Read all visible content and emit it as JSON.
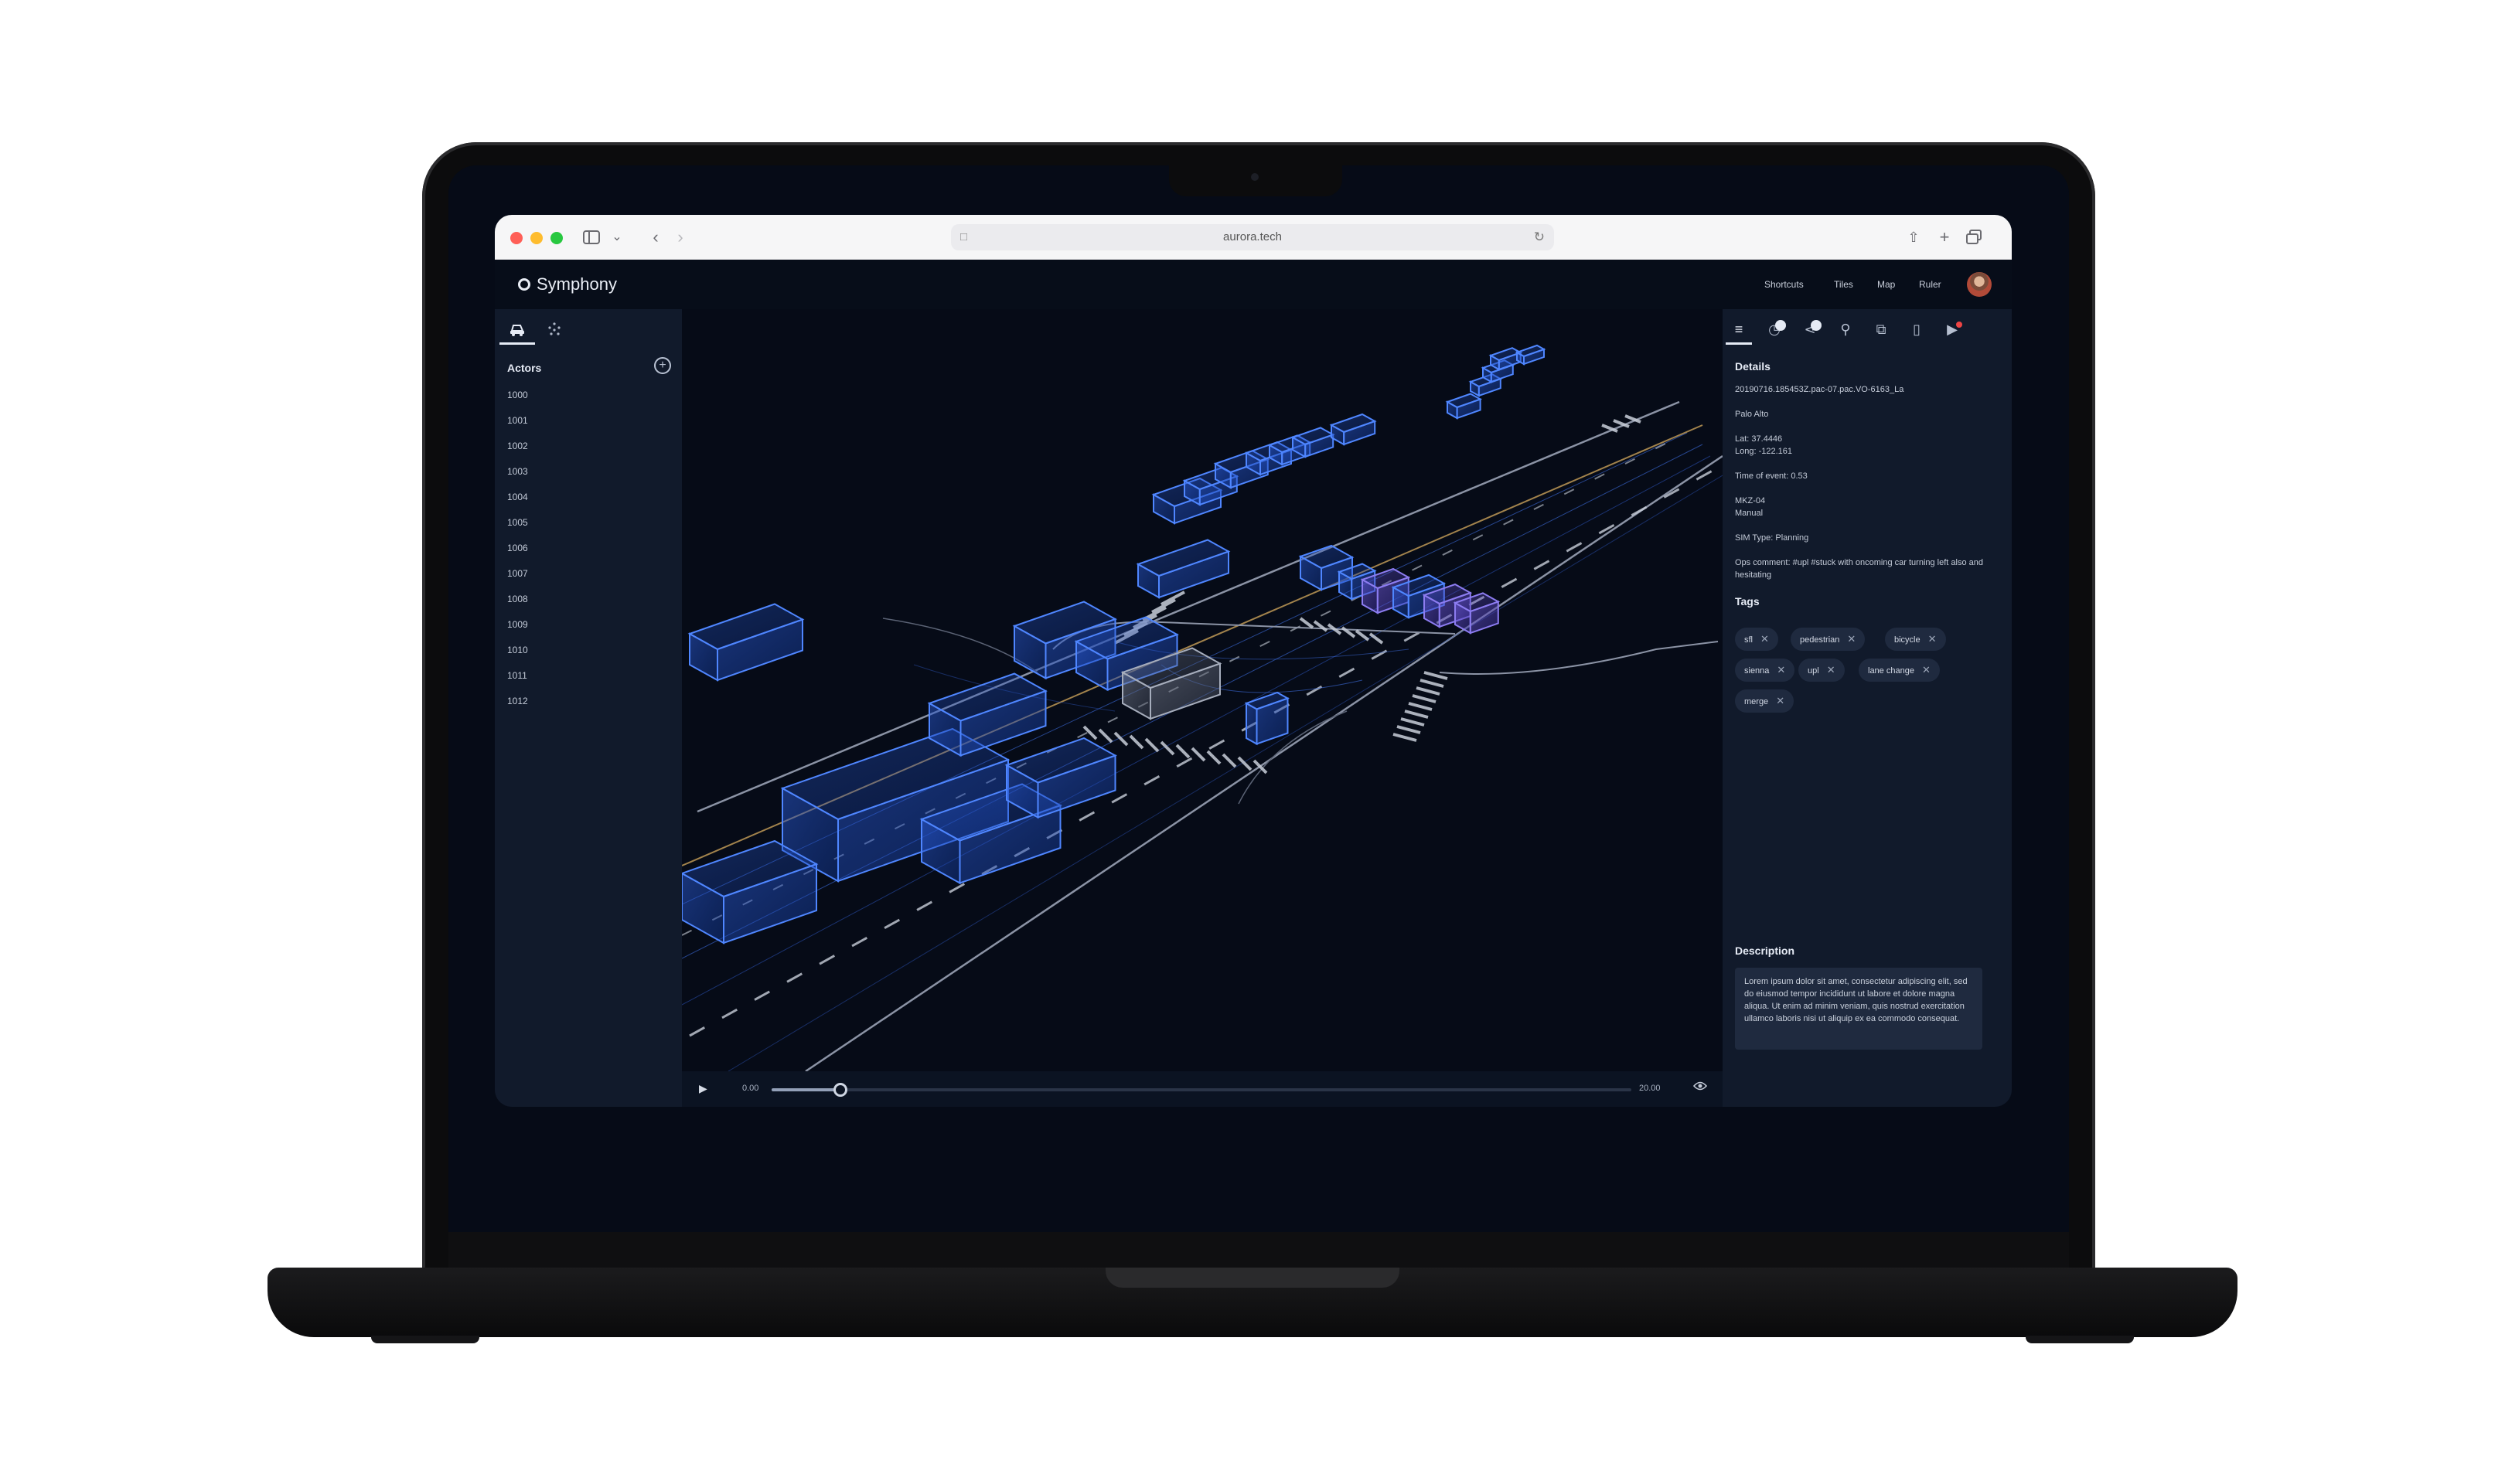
{
  "browser": {
    "url": "aurora.tech"
  },
  "app": {
    "name": "Symphony",
    "nav": [
      "Shortcuts",
      "Tiles",
      "Map",
      "Ruler"
    ]
  },
  "left_panel": {
    "title": "Actors",
    "actors": [
      "1000",
      "1001",
      "1002",
      "1003",
      "1004",
      "1005",
      "1006",
      "1007",
      "1008",
      "1009",
      "1010",
      "1011",
      "1012"
    ]
  },
  "timeline": {
    "start": "0.00",
    "end": "20.00",
    "progress": 0.08
  },
  "right_panel": {
    "icons": [
      "list-icon",
      "timer-icon",
      "share-icon",
      "pin-icon",
      "layers-icon",
      "battery-icon",
      "play-circle-icon"
    ],
    "details": {
      "title": "Details",
      "id": "20190716.185453Z.pac-07.pac.VO-6163_La",
      "location": "Palo Alto",
      "lat": "Lat: 37.4446",
      "long": "Long: -122.161",
      "time": "Time of event: 0.53",
      "vehicle": "MKZ-04",
      "mode": "Manual",
      "sim_type": "SIM Type: Planning",
      "ops_comment": "Ops comment: #upl #stuck with oncoming car turning left also and hesitating"
    },
    "tags_title": "Tags",
    "tags": [
      "sfl",
      "pedestrian",
      "bicycle",
      "sienna",
      "upl",
      "lane change",
      "merge"
    ],
    "description_title": "Description",
    "description": "Lorem ipsum dolor sit amet, consectetur adipiscing elit, sed do eiusmod tempor incididunt ut labore et dolore magna aliqua. Ut enim ad minim veniam, quis nostrud exercitation ullamco laboris nisi ut aliquip ex ea commodo consequat."
  },
  "colors": {
    "accent_blue": "#3b82f6",
    "panel": "#111a2b",
    "scene": "#060b17"
  }
}
